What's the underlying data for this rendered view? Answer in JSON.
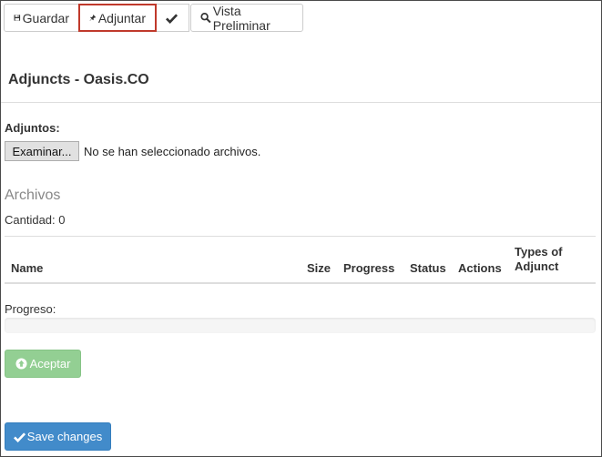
{
  "toolbar": {
    "save_label": "Guardar",
    "attach_label": "Adjuntar",
    "preview_label": "Vista Preliminar"
  },
  "page": {
    "title": "Adjuncts - Oasis.CO"
  },
  "upload": {
    "label": "Adjuntos:",
    "browse_label": "Examinar...",
    "no_files_text": "No se han seleccionado archivos."
  },
  "files": {
    "section_title": "Archivos",
    "count_label": "Cantidad: ",
    "count_value": "0",
    "columns": [
      "Name",
      "Size",
      "Progress",
      "Status",
      "Actions",
      "Types of Adjunct"
    ]
  },
  "progress": {
    "label": "Progreso:",
    "value_percent": 0
  },
  "actions": {
    "accept_label": "Aceptar",
    "save_changes_label": "Save changes"
  },
  "colors": {
    "accept_bg": "#93cf93",
    "save_bg": "#428bca",
    "highlight_border": "#c0392b"
  },
  "icons": {
    "save": "floppy-disk-icon",
    "attach": "pushpin-icon",
    "check": "checkmark-icon",
    "preview": "search-icon",
    "accept": "upload-circle-icon",
    "save_changes": "checkmark-icon"
  }
}
